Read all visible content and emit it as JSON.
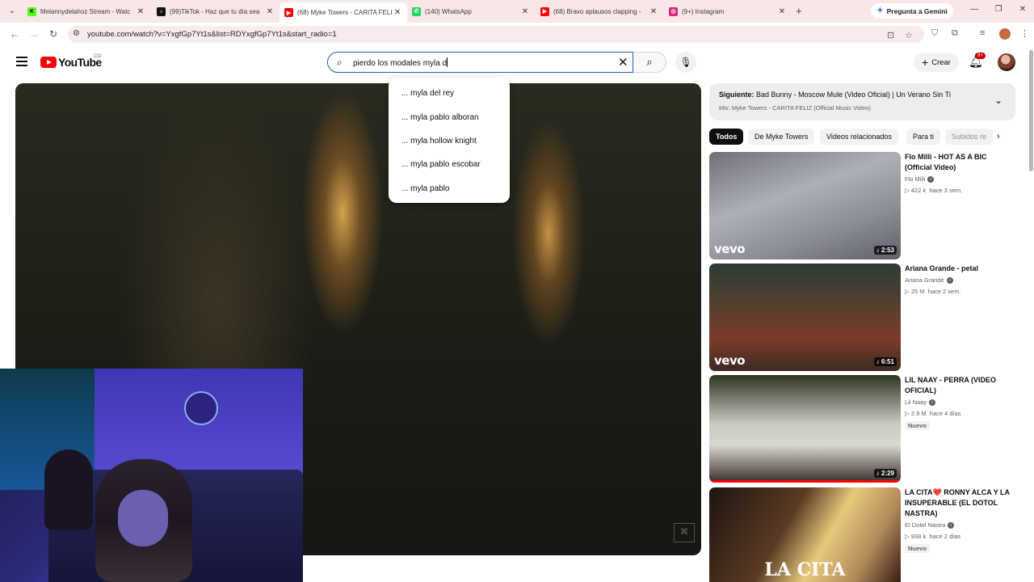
{
  "browser": {
    "tabs": [
      {
        "title": "Melannydelahoz Stream - Watc",
        "fav_color": "#53fc18",
        "fav_glyph": "K"
      },
      {
        "title": "(99)TikTok - Haz que tu día sea",
        "fav_color": "#111111",
        "fav_glyph": "♪"
      },
      {
        "title": "(68) Myke Towers - CARITA FELI",
        "fav_color": "#ff0000",
        "fav_glyph": "▶"
      },
      {
        "title": "(140) WhatsApp",
        "fav_color": "#25d366",
        "fav_glyph": "✆"
      },
      {
        "title": "(68) Bravo aplausos clapping -",
        "fav_color": "#ff0000",
        "fav_glyph": "▶"
      },
      {
        "title": "(9+) Instagram",
        "fav_color": "#d62976",
        "fav_glyph": "◎"
      }
    ],
    "new_tab": "+",
    "gemini_label": "Pregunta a Gemini",
    "url": "youtube.com/watch?v=YxgfGp7Yt1s&list=RDYxgfGp7Yt1s&start_radio=1"
  },
  "youtube": {
    "logo_text": "YouTube",
    "country": "CO",
    "search_query": "pierdo los modales myla d",
    "create_label": "Crear",
    "notifications": "9+"
  },
  "suggestions": [
    "... myla del rey",
    "... myla pablo alboran",
    "... myla hollow knight",
    "... myla pablo escobar",
    "... myla pablo"
  ],
  "playlist": {
    "next_label": "Siguiente:",
    "next_title": "Bad Bunny - Moscow Mule (Video Oficial) | Un Verano Sin Ti",
    "mix_title": "Mix: Myke Towers - CARITA FELIZ (Official Music Video)"
  },
  "chips": [
    "Todos",
    "De Myke Towers",
    "Videos relacionados",
    "Para ti",
    "Subidos re"
  ],
  "videos": [
    {
      "title": "Flo Milli - HOT AS A BIC (Official Video)",
      "channel": "Flo Milli",
      "views": "▷ 422 k",
      "age": "hace 3 sem.",
      "duration": "♪ 2:53",
      "thumb_label": "vevo",
      "badge": ""
    },
    {
      "title": "Ariana Grande - petal",
      "channel": "Ariana Grande",
      "views": "▷ 25 M",
      "age": "hace 2 sem.",
      "duration": "♪ 6:51",
      "thumb_label": "vevo",
      "badge": ""
    },
    {
      "title": "LIL NAAY - PERRA (VIDEO OFICIAL)",
      "channel": "Lil Naay",
      "views": "▷ 2.9 M",
      "age": "hace 4 días",
      "duration": "♪ 2:29",
      "thumb_label": "",
      "badge": "Nuevo"
    },
    {
      "title": "LA CITA❤️ RONNY ALCA Y LA INSUPERABLE (EL DOTOL NASTRA)",
      "channel": "El Dotol Nastra",
      "views": "▷ 938 k",
      "age": "hace 2 días",
      "duration": "",
      "thumb_label": "LA CITA",
      "badge": "Nuevo"
    }
  ]
}
